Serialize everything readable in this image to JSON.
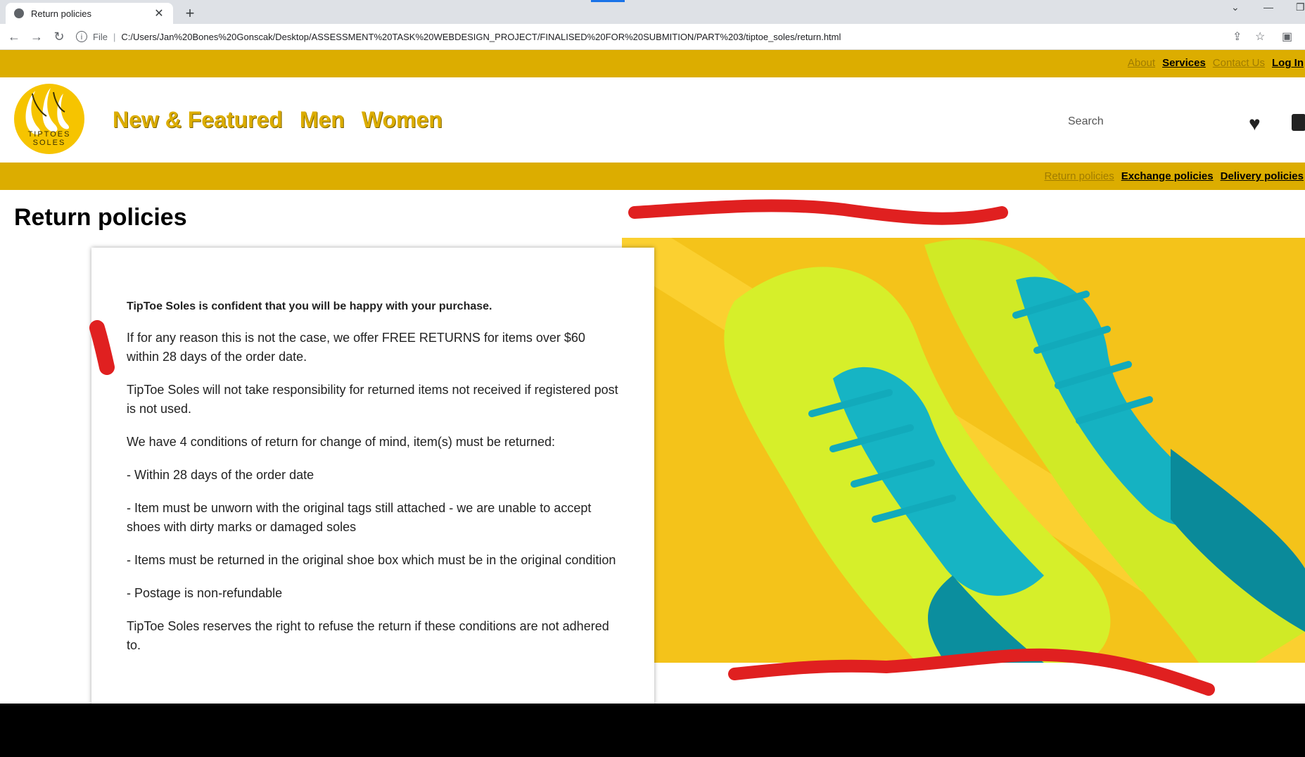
{
  "browser": {
    "tab_title": "Return policies",
    "url_scheme": "File",
    "url": "C:/Users/Jan%20Bones%20Gonscak/Desktop/ASSESSMENT%20TASK%20WEBDESIGN_PROJECT/FINALISED%20FOR%20SUBMITION/PART%203/tiptoe_soles/return.html"
  },
  "top_nav": {
    "about": "About",
    "services": "Services",
    "contact": "Contact Us",
    "login": "Log In"
  },
  "logo": {
    "line1": "TIPTOES",
    "line2": "SOLES"
  },
  "main_nav": {
    "new_featured": "New & Featured",
    "men": "Men",
    "women": "Women"
  },
  "search": {
    "placeholder": "Search"
  },
  "sub_nav": {
    "return": "Return policies",
    "exchange": "Exchange policies",
    "delivery": "Delivery policies"
  },
  "page": {
    "title": "Return policies",
    "lead": "TipToe Soles is confident that you will be happy with your purchase.",
    "p1": "If for any reason this is not the case, we offer FREE RETURNS for items over $60 within 28 days of the order date.",
    "p2": "TipToe Soles will not take responsibility for returned items not received if registered post is not used.",
    "p3": "We have 4 conditions of return for change of mind, item(s) must be returned:",
    "c1": "- Within 28 days of the order date",
    "c2": "- Item must be unworn with the original tags still attached - we are unable to accept shoes with dirty marks or damaged soles",
    "c3": "- Items must be returned in the original shoe box which must be in the original condition",
    "c4": "- Postage is non-refundable",
    "p4": "TipToe Soles reserves the right to refuse the return if these conditions are not adhered to."
  },
  "colors": {
    "brand_yellow": "#dcad00",
    "annotation_red": "#e02020"
  }
}
